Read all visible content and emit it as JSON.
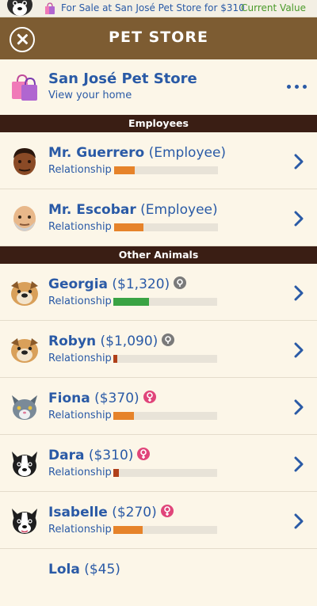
{
  "status_bar": {
    "message": "For Sale at San José Pet Store for $310",
    "current_value_link": "Current Value",
    "avatar_icon": "dog-avatar-icon",
    "bag_icon": "shopping-bag-icon"
  },
  "header": {
    "title": "PET STORE",
    "close_icon": "close-icon"
  },
  "store": {
    "name": "San José Pet Store",
    "subtitle": "View your home",
    "icon": "shopping-bags-icon",
    "more_icon": "more-options-icon"
  },
  "sections": {
    "employees": "Employees",
    "other_animals": "Other Animals"
  },
  "employees": [
    {
      "name": "Mr. Guerrero",
      "suffix": "(Employee)",
      "relationship_label": "Relationship",
      "relationship": 0.2,
      "bar_color": "#e6832a",
      "avatar": "dark-skin-man-avatar"
    },
    {
      "name": "Mr. Escobar",
      "suffix": "(Employee)",
      "relationship_label": "Relationship",
      "relationship": 0.28,
      "bar_color": "#e6832a",
      "avatar": "bald-older-man-avatar"
    }
  ],
  "animals": [
    {
      "name": "Georgia",
      "price": "($1,320)",
      "gender": "neutral",
      "relationship_label": "Relationship",
      "relationship": 0.34,
      "bar_color": "#3aa344",
      "avatar": "bulldog-avatar"
    },
    {
      "name": "Robyn",
      "price": "($1,090)",
      "gender": "neutral",
      "relationship_label": "Relationship",
      "relationship": 0.04,
      "bar_color": "#b0401a",
      "avatar": "bulldog-avatar"
    },
    {
      "name": "Fiona",
      "price": "($370)",
      "gender": "female",
      "relationship_label": "Relationship",
      "relationship": 0.2,
      "bar_color": "#e6832a",
      "avatar": "gray-cat-avatar"
    },
    {
      "name": "Dara",
      "price": "($310)",
      "gender": "female",
      "relationship_label": "Relationship",
      "relationship": 0.05,
      "bar_color": "#b0401a",
      "avatar": "boston-terrier-avatar"
    },
    {
      "name": "Isabelle",
      "price": "($270)",
      "gender": "female",
      "relationship_label": "Relationship",
      "relationship": 0.28,
      "bar_color": "#e6832a",
      "avatar": "boston-terrier-avatar"
    },
    {
      "name": "Lola",
      "price": "($45)",
      "gender": "",
      "relationship_label": "",
      "relationship": 0,
      "bar_color": "#e6832a",
      "avatar": ""
    }
  ],
  "colors": {
    "header_bg": "#7d5c32",
    "section_bg": "#3a1e14",
    "page_bg": "#fcf6e8",
    "link_blue": "#2a5aa6",
    "value_green": "#4a9a2a",
    "female_pink": "#e0457a",
    "neutral_gray": "#7a7a7a"
  }
}
